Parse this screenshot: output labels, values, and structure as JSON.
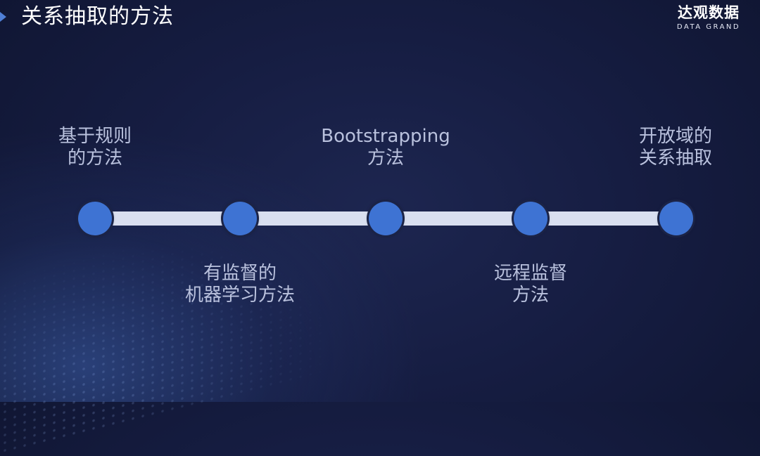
{
  "slide": {
    "title": "关系抽取的方法"
  },
  "logo": {
    "name_cn": "达观数据",
    "name_en": "DATA GRAND"
  },
  "timeline": {
    "colors": {
      "track": "#d9dff0",
      "node": "#3e73d3",
      "label": "#b9c1dd"
    },
    "steps": [
      {
        "line1": "基于规则",
        "line2": "的方法",
        "position": "above"
      },
      {
        "line1": "有监督的",
        "line2": "机器学习方法",
        "position": "below"
      },
      {
        "line1": "Bootstrapping",
        "line2": "方法",
        "position": "above"
      },
      {
        "line1": "远程监督",
        "line2": "方法",
        "position": "below"
      },
      {
        "line1": "开放域的",
        "line2": "关系抽取",
        "position": "above"
      }
    ]
  }
}
